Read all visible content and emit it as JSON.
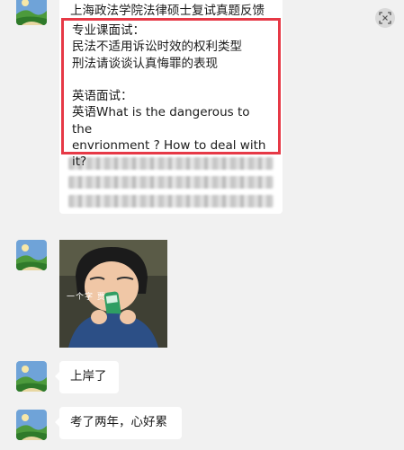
{
  "message1": {
    "cut_title": "上海政法学院法律硕士复试真题反馈",
    "lines": [
      "专业课面试：",
      "民法不适用诉讼时效的权利类型",
      "刑法请谈谈认真悔罪的表现",
      "",
      "英语面试：",
      "英语What is the dangerous to the",
      "envrionment ? How to deal with",
      "it?"
    ]
  },
  "message2": {
    "sticker_caption": "一个字 贾"
  },
  "message3": {
    "text": "上岸了"
  },
  "message4": {
    "text": "考了两年，心好累"
  },
  "colors": {
    "highlight": "#e63946",
    "bubble": "#ffffff",
    "background": "#f1f1f1"
  },
  "icons": {
    "expand": "expand-icon",
    "avatar": "landscape-avatar"
  }
}
